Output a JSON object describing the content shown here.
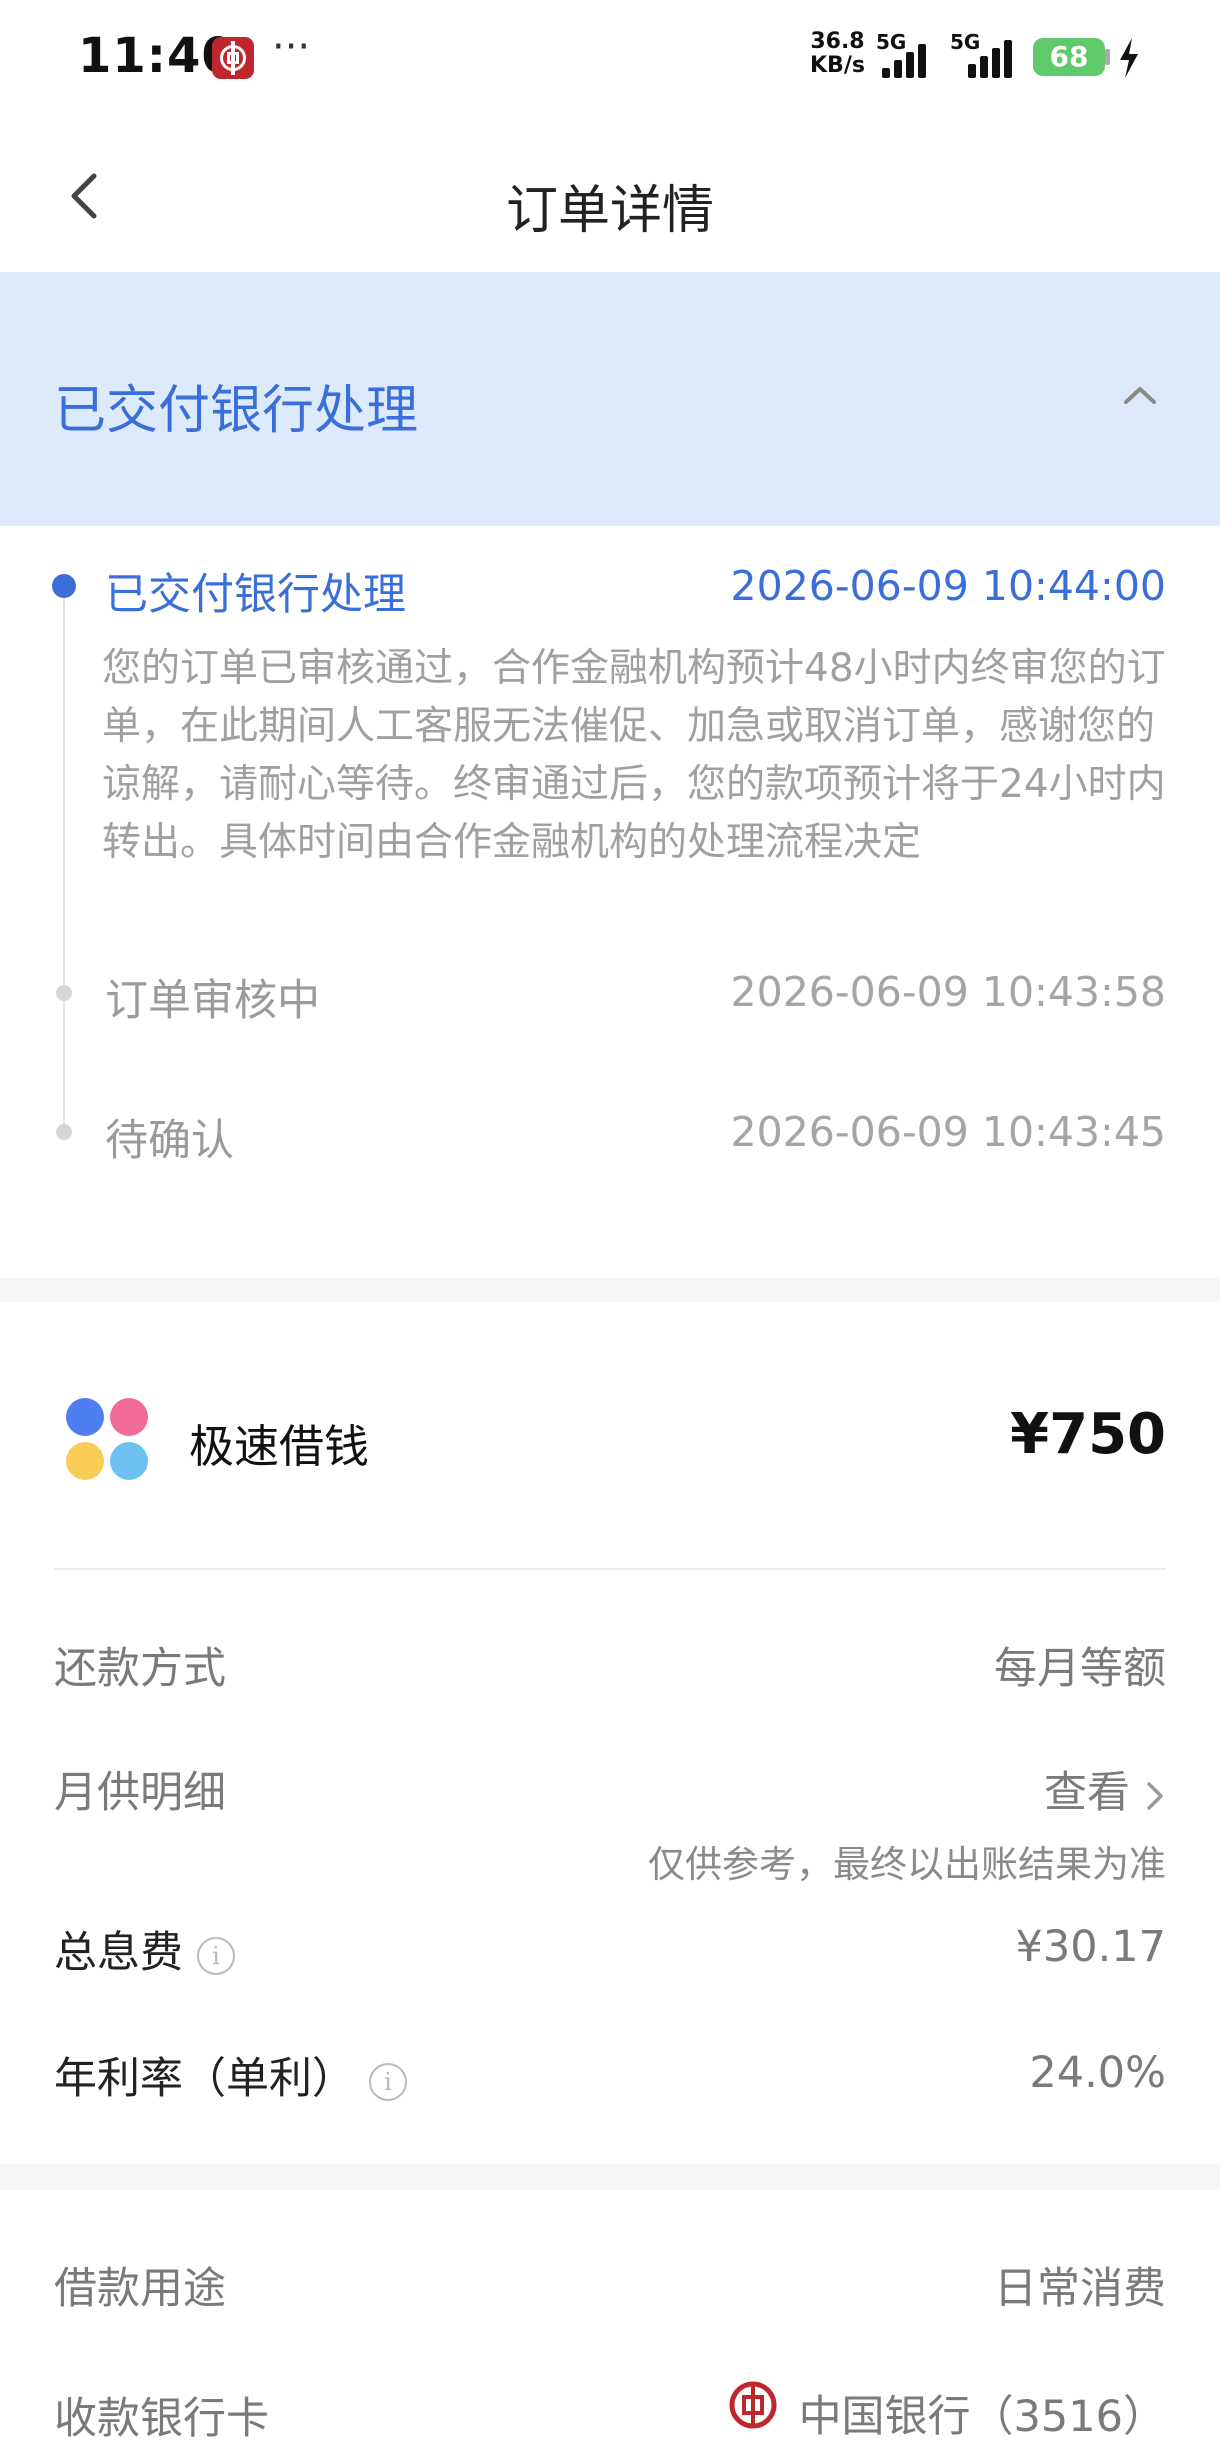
{
  "status_bar": {
    "time": "11:40",
    "more": "···",
    "net_speed_value": "36.8",
    "net_speed_unit": "KB/s",
    "signal1_label": "5G",
    "signal2_label": "5G",
    "battery": "68"
  },
  "nav": {
    "title": "订单详情"
  },
  "banner": {
    "title": "已交付银行处理"
  },
  "timeline": [
    {
      "title": "已交付银行处理",
      "time": "2026-06-09 10:44:00",
      "desc": "您的订单已审核通过，合作金融机构预计48小时内终审您的订单，在此期间人工客服无法催促、加急或取消订单，感谢您的谅解，请耐心等待。终审通过后，您的款项预计将于24小时内转出。具体时间由合作金融机构的处理流程决定"
    },
    {
      "title": "订单审核中",
      "time": "2026-06-09 10:43:58"
    },
    {
      "title": "待确认",
      "time": "2026-06-09 10:43:45"
    }
  ],
  "product": {
    "name": "极速借钱",
    "amount": "¥750"
  },
  "details": {
    "repay_method_label": "还款方式",
    "repay_method_value": "每月等额",
    "monthly_label": "月供明细",
    "monthly_link": "查看",
    "monthly_note": "仅供参考，最终以出账结果为准",
    "interest_label": "总息费",
    "interest_value": "¥30.17",
    "rate_label": "年利率（单利）",
    "rate_value": "24.0%"
  },
  "loan": {
    "purpose_label": "借款用途",
    "purpose_value": "日常消费",
    "card_label": "收款银行卡",
    "card_value": "中国银行（3516）"
  },
  "colors": {
    "accent": "#3a6fd9",
    "banner_bg": "#ddeafb",
    "battery": "#5fc96b",
    "bank_red": "#c0272d"
  },
  "icons": [
    "boc-app-icon",
    "back-arrow-icon",
    "chevron-up-icon",
    "info-icon",
    "chevron-right-icon",
    "product-logo-icon",
    "bank-logo-icon"
  ]
}
